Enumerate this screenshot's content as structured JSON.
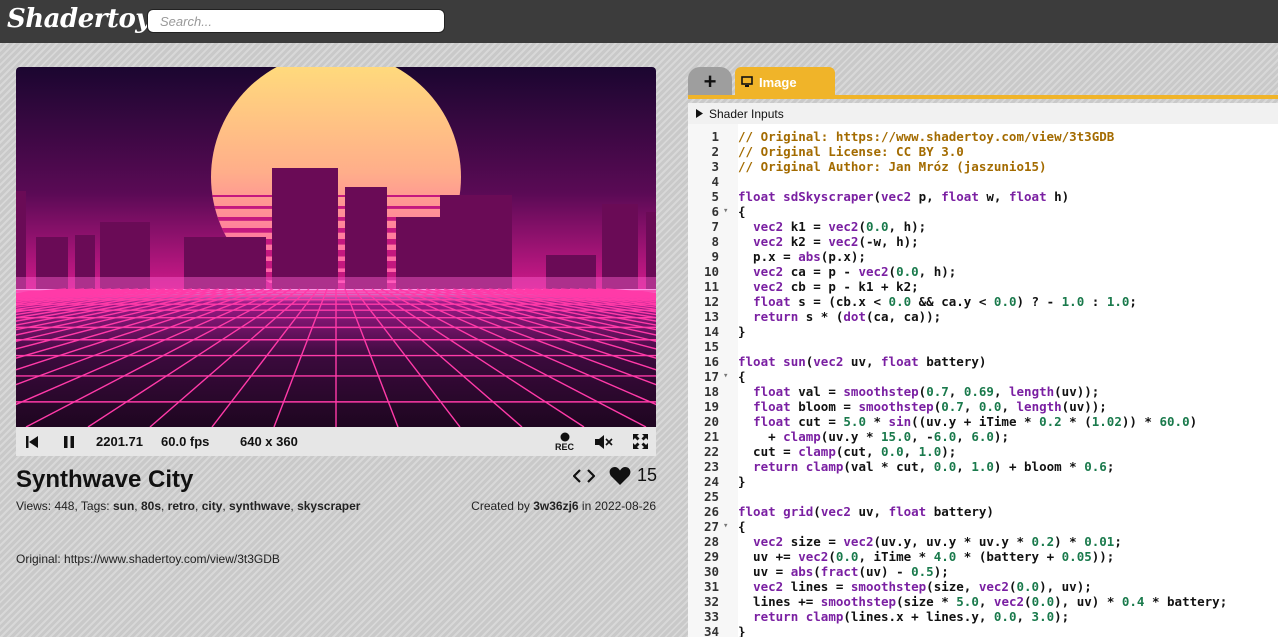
{
  "app": {
    "logo": "Shadertoy"
  },
  "search": {
    "placeholder": "Search..."
  },
  "player": {
    "time": "2201.71",
    "fps": "60.0 fps",
    "resolution": "640 x 360",
    "rec_label": "REC"
  },
  "shader": {
    "title": "Synthwave City",
    "views_label": "Views: 448, Tags: ",
    "tags": [
      "sun",
      "80s",
      "retro",
      "city",
      "synthwave",
      "skyscraper"
    ],
    "created_prefix": "Created by ",
    "author": "3w36zj6",
    "created_mid": " in ",
    "date": "2022-08-26",
    "likes": "15",
    "description": "Original: https://www.shadertoy.com/view/3t3GDB"
  },
  "editor": {
    "tab_plus": "+",
    "tab_image": "Image",
    "inputs_label": "Shader Inputs",
    "lines": [
      "// Original: https://www.shadertoy.com/view/3t3GDB",
      "// Original License: CC BY 3.0",
      "// Original Author: Jan Mróz (jaszunio15)",
      "",
      "float sdSkyscraper(vec2 p, float w, float h)",
      "{",
      "  vec2 k1 = vec2(0.0, h);",
      "  vec2 k2 = vec2(-w, h);",
      "  p.x = abs(p.x);",
      "  vec2 ca = p - vec2(0.0, h);",
      "  vec2 cb = p - k1 + k2;",
      "  float s = (cb.x < 0.0 && ca.y < 0.0) ? - 1.0 : 1.0;",
      "  return s * (dot(ca, ca));",
      "}",
      "",
      "float sun(vec2 uv, float battery)",
      "{",
      "  float val = smoothstep(0.7, 0.69, length(uv));",
      "  float bloom = smoothstep(0.7, 0.0, length(uv));",
      "  float cut = 5.0 * sin((uv.y + iTime * 0.2 * (1.02)) * 60.0)",
      "    + clamp(uv.y * 15.0, -6.0, 6.0);",
      "  cut = clamp(cut, 0.0, 1.0);",
      "  return clamp(val * cut, 0.0, 1.0) + bloom * 0.6;",
      "}",
      "",
      "float grid(vec2 uv, float battery)",
      "{",
      "  vec2 size = vec2(uv.y, uv.y * uv.y * 0.2) * 0.01;",
      "  uv += vec2(0.0, iTime * 4.0 * (battery + 0.05));",
      "  uv = abs(fract(uv) - 0.5);",
      "  vec2 lines = smoothstep(size, vec2(0.0), uv);",
      "  lines += smoothstep(size * 5.0, vec2(0.0), uv) * 0.4 * battery;",
      "  return clamp(lines.x + lines.y, 0.0, 3.0);",
      "}"
    ],
    "fold_lines": [
      6,
      17,
      27
    ]
  },
  "colors": {
    "accent": "#f0b429",
    "topbar": "#3c3c3c"
  }
}
